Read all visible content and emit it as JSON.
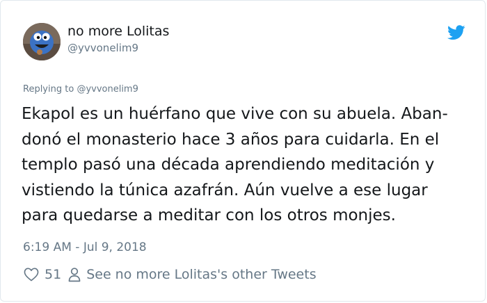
{
  "user": {
    "display_name": "no more Lolitas",
    "handle": "@yvvonelim9"
  },
  "reply": {
    "prefix": "Replying to ",
    "mention": "@yvvonelim9"
  },
  "tweet": {
    "lines": [
      "Ekapol es un huérfano que vive con su abuela. Aban-",
      "donó el monasterio hace 3 años para cuidarla. En el",
      "templo pasó una década aprendiendo meditación y",
      "vistiendo la túnica azafrán. Aún vuelve a ese lugar",
      "para quedarse a meditar con los otros monjes."
    ],
    "timestamp": "6:19 AM - Jul 9, 2018"
  },
  "actions": {
    "like_count": "51",
    "other_tweets_label": "See no more Lolitas's other Tweets"
  },
  "icons": {
    "brand": "twitter-bird-icon",
    "like": "heart-icon",
    "profile": "person-icon"
  },
  "colors": {
    "brand": "#1da1f2",
    "text": "#14171a",
    "secondary": "#657786",
    "border": "#e1e8ed"
  }
}
